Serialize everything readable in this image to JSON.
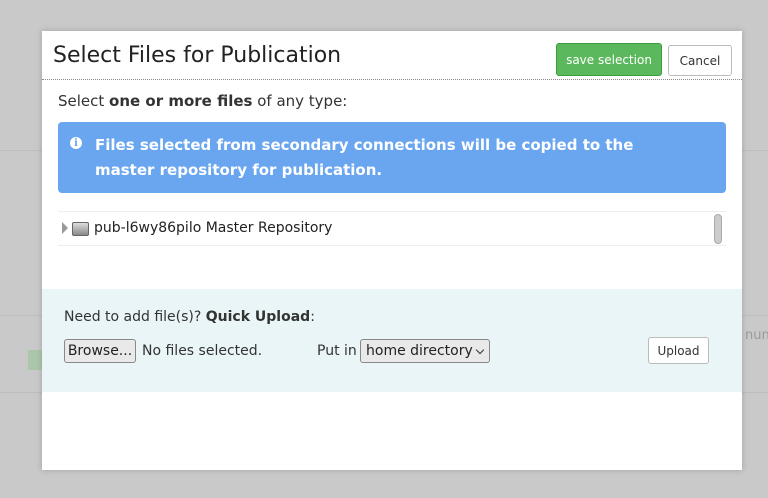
{
  "background": {
    "right_fragment": "nun"
  },
  "modal": {
    "title": "Select Files for Publication",
    "save_label": "save selection",
    "cancel_label": "Cancel",
    "instruction": {
      "prefix": "Select ",
      "bold": "one or more files",
      "suffix": " of any type:"
    },
    "alert": {
      "icon": "info-icon",
      "text": "Files selected from secondary connections will be copied to the master repository for publication."
    },
    "tree": {
      "items": [
        {
          "label": "pub-l6wy86pilo Master Repository",
          "icon": "drive-icon"
        }
      ]
    },
    "upload": {
      "prompt_prefix": "Need to add file(s)? ",
      "prompt_bold": "Quick Upload",
      "prompt_suffix": ":",
      "browse_label": "Browse...",
      "file_status": "No files selected.",
      "put_in_label": "Put in",
      "directory_selected": "home directory",
      "upload_label": "Upload"
    }
  },
  "colors": {
    "save": "#5cb85c",
    "alert": "#6aa6f0",
    "upload_panel": "#e9f5f6"
  }
}
